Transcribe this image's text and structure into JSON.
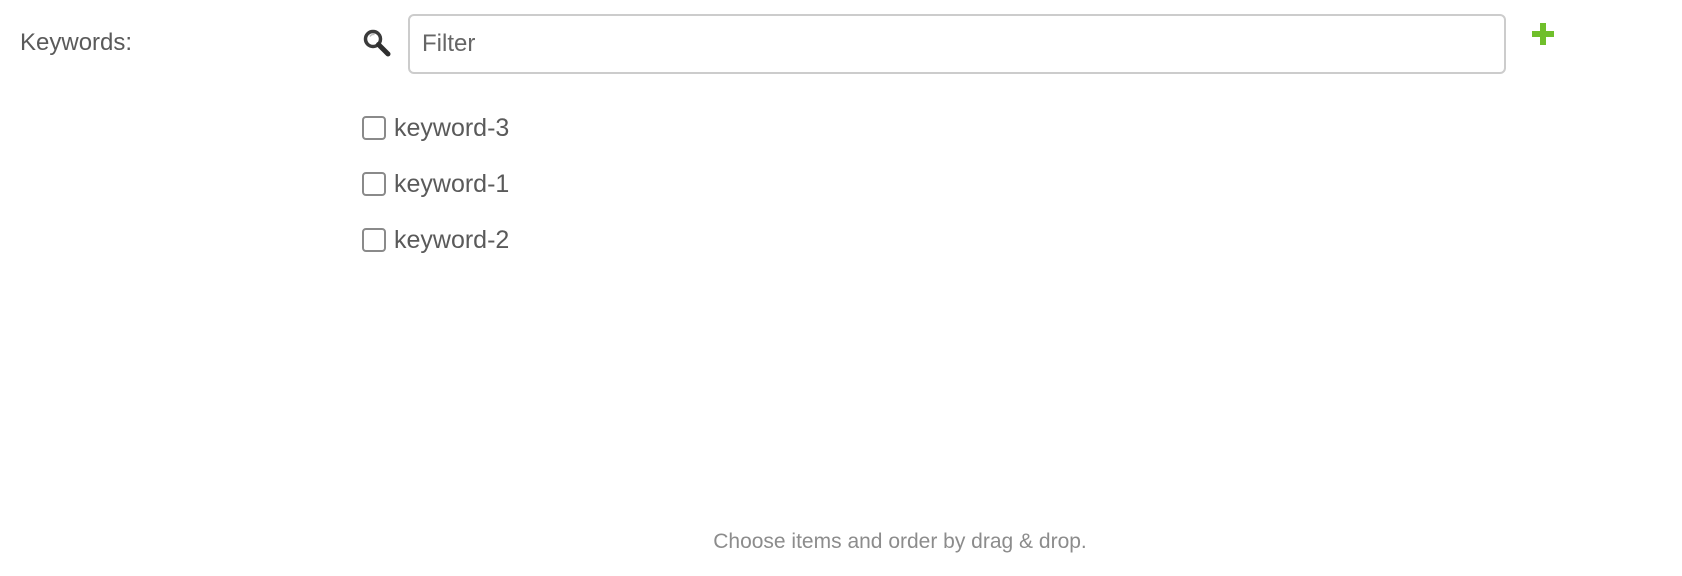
{
  "field": {
    "label": "Keywords:"
  },
  "filter": {
    "placeholder": "Filter",
    "value": ""
  },
  "icons": {
    "search": "search-icon",
    "add": "plus-icon",
    "add_color": "#70bf2b"
  },
  "keywords": [
    {
      "label": "keyword-3",
      "checked": false
    },
    {
      "label": "keyword-1",
      "checked": false
    },
    {
      "label": "keyword-2",
      "checked": false
    }
  ],
  "help_text": "Choose items and order by drag & drop."
}
